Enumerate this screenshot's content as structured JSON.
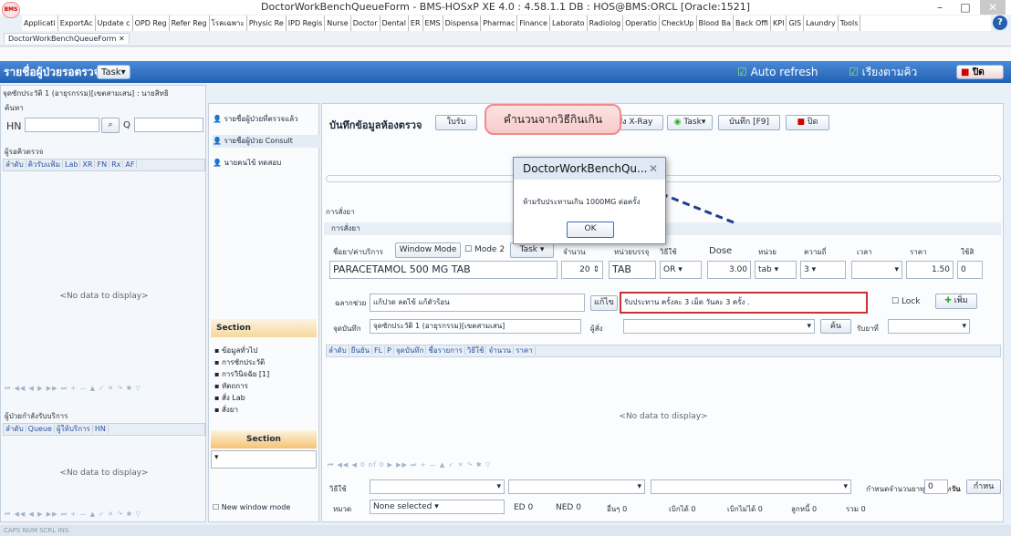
{
  "window": {
    "title": "DoctorWorkBenchQueueForm - BMS-HOSxP XE 4.0 : 4.58.1.1 DB : HOS@BMS:ORCL [Oracle:1521]",
    "logo_text": "BMS",
    "min": "–",
    "restore": "□",
    "close": "✕"
  },
  "menu": [
    "Applicati",
    "ExportAc",
    "Update c",
    "OPD Reg",
    "Refer Reg",
    "โรคเฉพาะ",
    "Physic Re",
    "IPD Regis",
    "Nurse",
    "Doctor",
    "Dental",
    "ER",
    "EMS",
    "Dispensa",
    "Pharmac",
    "Finance",
    "Laborato",
    "Radiolog",
    "Operatio",
    "CheckUp",
    "Blood Ba",
    "Back Offi",
    "KPI",
    "GIS",
    "Laundry",
    "Tools"
  ],
  "help": "?",
  "doc_tab": {
    "label": "DoctorWorkBenchQueueForm",
    "close": "✕"
  },
  "toolbar": {
    "title": "รายชื่อผู้ป่วยรอตรวจ",
    "task": "Task▾",
    "auto_refresh": "Auto refresh",
    "sort_queue": "เรียงตามคิว",
    "close": "ปิด"
  },
  "left": {
    "sig_label": "จุดซักประวัติ 1 (อายุรกรรม)[เขตสามเสน] : นายสิทธิ",
    "search_label": "ค้นหา",
    "hn_label": "HN",
    "q_label": "Q",
    "waiting_label": "ผู้รอคิวตรวจ",
    "cols": [
      "ลำดับ",
      "คิวรับแฟ้ม",
      "Lab",
      "XR",
      "FN",
      "Rx",
      "AF"
    ],
    "no_data": "<No data to display>",
    "service_label": "ผู้ป่วยกำลังรับบริการ",
    "cols2": [
      "ลำดับ",
      "Queue",
      "ผู้ให้บริการ",
      "HN"
    ],
    "nav": "⏮ ◀◀ ◀ ▶ ▶▶ ⏭ + — ▲ ✓ ✕ ↷ ✱ ▽"
  },
  "mid": {
    "items": [
      "รายชื่อผู้ป่วยที่ตรวจแล้ว",
      "รายชื่อผู้ป่วย Consult",
      "นายคนไข้ ทดสอบ"
    ],
    "section": "Section",
    "tree": [
      "ข้อมูลทั่วไป",
      "การซักประวัติ",
      "การวินิจฉัย [1]",
      "หัตถการ",
      "สั่ง Lab",
      "สั่งยา"
    ],
    "section2": "Section",
    "new_window": "New window mode"
  },
  "record": {
    "title": "บันทึกข้อมูลห้องตรวจ",
    "btn_receive": "ใบรับ",
    "btn_xray": "สั่ง X-Ray",
    "btn_task": "Task▾",
    "btn_save": "บันทึก [F9]",
    "btn_close": "ปิด",
    "order_label": "การสั่งยา",
    "order_tab": "การสั่งยา",
    "col_drug": "ชื่อยา/ค่าบริการ",
    "window_mode": "Window Mode",
    "mode2": "Mode 2",
    "task2": "Task ▾",
    "col_qty": "จำนวน",
    "col_unit": "หน่วยบรรจุ",
    "col_usage": "วิธีใช้",
    "col_dose": "Dose",
    "col_doseunit": "หน่วย",
    "col_freq": "ความถี่",
    "col_time": "เวลา",
    "col_price": "ราคา",
    "col_use": "ใช้สิ",
    "drug_name": "PARACETAMOL 500 MG TAB",
    "qty": "20",
    "unit": "TAB",
    "usage_code": "OR",
    "dose": "3.00",
    "dose_unit": "tab",
    "freq": "3",
    "price": "1.50",
    "extra": "0",
    "label_aux": "ฉลากช่วย",
    "aux_value": "แก้ปวด ลดไข้ แก้ตัวร้อน",
    "edit_btn": "แก้ไข",
    "usage_text": "รับประทาน ครั้งละ 3 เม็ด วันละ 3 ครั้ง .",
    "lock": "Lock",
    "add": "เพิ่ม",
    "record_point": "จุดบันทึก",
    "record_point_value": "จุดซักประวัติ 1 (อายุรกรรม)[เขตสามเสน]",
    "orderer": "ผู้สั่ง",
    "search": "ค้น",
    "item_code": "รับยาที่",
    "grid_cols": [
      "ลำดับ",
      "ยืนยัน",
      "FL",
      "P",
      "จุดบันทึก",
      "ชื่อรายการ",
      "วิธีใช้",
      "จำนวน",
      "ราคา"
    ],
    "no_data": "<No data to display>",
    "nav2": "⏮ ◀◀ ◀  0 of 0  ▶ ▶▶ ⏭ + — ▲ ✓ ✕ ↷ ✱ ▽",
    "usage_label": "วิธีใช้",
    "calc_label": "กำหนดจำนวนยาทุกตัวสำหรับ",
    "calc_value": "0",
    "day": "วัน",
    "apply": "กำหน",
    "cat_label": "หมวด",
    "cat_value": "None selected",
    "ed": "ED",
    "ed_val": "0",
    "ned": "NED",
    "ned_val": "0",
    "other": "อื่นๆ",
    "other_val": "0",
    "reimb": "เบิกได้",
    "reimb_val": "0",
    "nonreimb": "เบิกไม่ได้",
    "nonreimb_val": "0",
    "debtor": "ลูกหนี้",
    "debtor_val": "0",
    "total": "รวม",
    "total_val": "0"
  },
  "tooltip": "คำนวนจากวิธีกินเกิน",
  "dialog": {
    "title": "DoctorWorkBenchQu...",
    "close": "✕",
    "message": "ห้ามรับประทานเกิน 1000MG ต่อครั้ง",
    "ok": "OK"
  },
  "status": {
    "caps": "CAPS",
    "num": "NUM",
    "scrl": "SCRL",
    "ins": "INS"
  },
  "colors": {
    "accent": "#2260b5",
    "alert": "#c83232",
    "tooltip": "#f8caca"
  }
}
